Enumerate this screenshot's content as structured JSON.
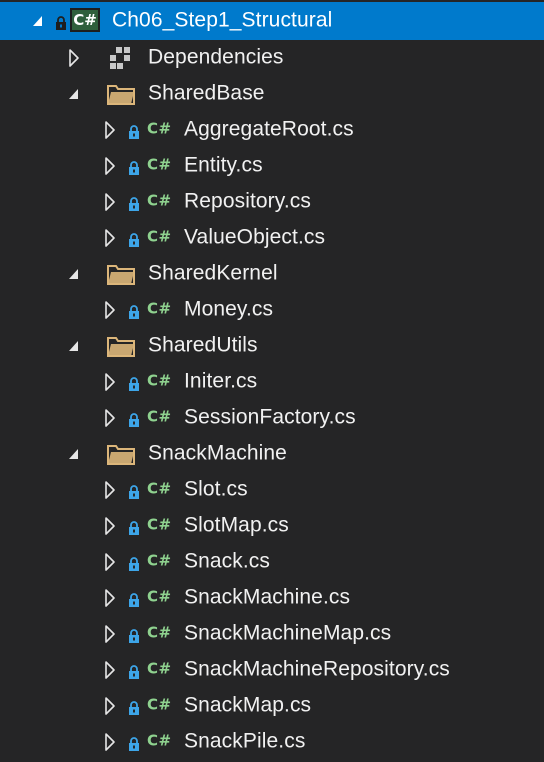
{
  "project": {
    "name": "Ch06_Step1_Structural",
    "badge": "C#"
  },
  "csharp_badge": "C#",
  "colors": {
    "background": "#252526",
    "selection": "#007acc",
    "text": "#f1f1f1",
    "csharp_icon": "#8fd28f",
    "lock_icon": "#3da5e8",
    "folder": "#dcb67a"
  },
  "tree": [
    {
      "label": "Dependencies",
      "kind": "dependencies",
      "expanded": false,
      "icon": "dependencies-icon"
    },
    {
      "label": "SharedBase",
      "kind": "folder",
      "expanded": true,
      "icon": "folder-icon",
      "children": [
        "AggregateRoot.cs",
        "Entity.cs",
        "Repository.cs",
        "ValueObject.cs"
      ]
    },
    {
      "label": "SharedKernel",
      "kind": "folder",
      "expanded": true,
      "icon": "folder-icon",
      "children": [
        "Money.cs"
      ]
    },
    {
      "label": "SharedUtils",
      "kind": "folder",
      "expanded": true,
      "icon": "folder-icon",
      "children": [
        "Initer.cs",
        "SessionFactory.cs"
      ]
    },
    {
      "label": "SnackMachine",
      "kind": "folder",
      "expanded": true,
      "icon": "folder-icon",
      "children": [
        "Slot.cs",
        "SlotMap.cs",
        "Snack.cs",
        "SnackMachine.cs",
        "SnackMachineMap.cs",
        "SnackMachineRepository.cs",
        "SnackMap.cs",
        "SnackPile.cs"
      ]
    }
  ]
}
